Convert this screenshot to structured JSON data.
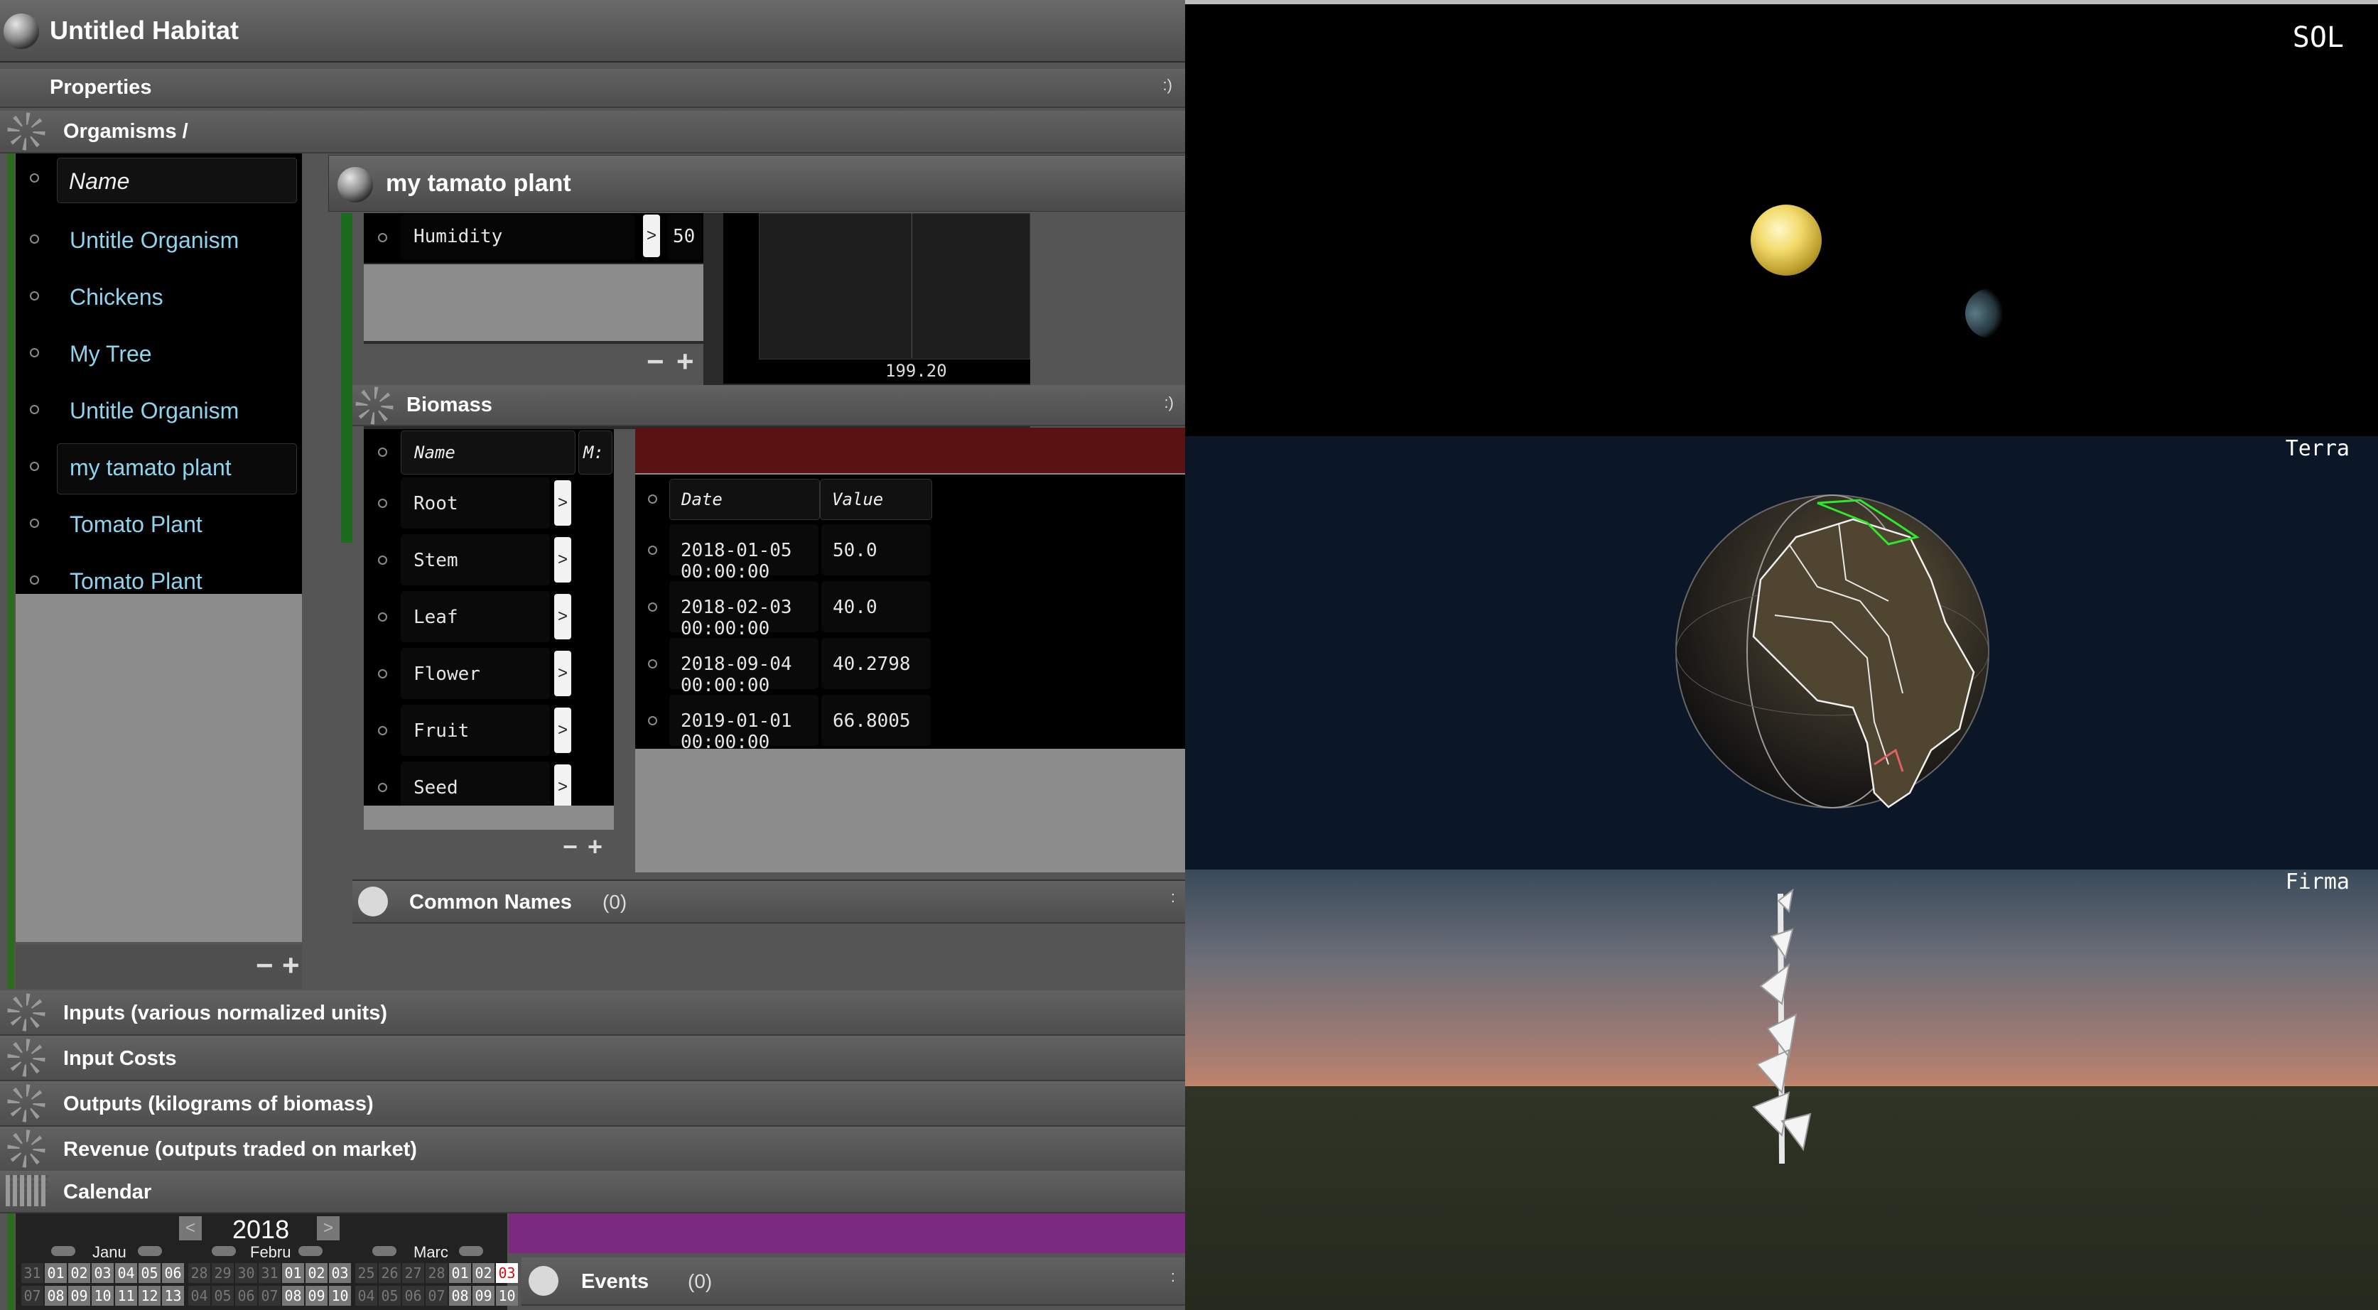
{
  "window": {
    "title": "Untitled Habitat"
  },
  "properties": {
    "label": "Properties",
    "ctrl": ":)"
  },
  "organisms": {
    "header": "Orgamisms /",
    "column_header": "Name",
    "items": [
      "Untitle Organism",
      "Chickens",
      "My Tree",
      "Untitle Organism",
      "my tamato plant",
      "Tomato Plant",
      "Tomato Plant"
    ],
    "selected_index": 4,
    "remove_label": "−",
    "add_label": "+"
  },
  "detail": {
    "title": "my tamato plant",
    "humidity": {
      "label": "Humidity",
      "arrow": ">",
      "value": "50"
    },
    "chart_readout": "199.20",
    "remove_label": "−",
    "add_label": "+"
  },
  "biomass": {
    "label": "Biomass",
    "ctrl": ":)",
    "name_header": "Name",
    "second_header": "M:",
    "parts": [
      {
        "name": "Root",
        "arrow": ">"
      },
      {
        "name": "Stem",
        "arrow": ">"
      },
      {
        "name": "Leaf",
        "arrow": ">"
      },
      {
        "name": "Flower",
        "arrow": ">"
      },
      {
        "name": "Fruit",
        "arrow": ">"
      },
      {
        "name": "Seed",
        "arrow": ">"
      }
    ],
    "table": {
      "date_header": "Date",
      "value_header": "Value",
      "rows": [
        {
          "date": "2018-01-05 00:00:00",
          "value": "50.0"
        },
        {
          "date": "2018-02-03 00:00:00",
          "value": "40.0"
        },
        {
          "date": "2018-09-04 00:00:00",
          "value": "40.2798"
        },
        {
          "date": "2019-01-01 00:00:00",
          "value": "66.8005"
        }
      ]
    },
    "remove_label": "−",
    "add_label": "+"
  },
  "common_names": {
    "label": "Common Names",
    "count": "(0)",
    "ctrl": ":"
  },
  "sections": [
    "Inputs (various normalized units)",
    "Input Costs",
    "Outputs (kilograms of biomass)",
    "Revenue (outputs traded on market)"
  ],
  "calendar": {
    "label": "Calendar",
    "year": "2018",
    "prev": "<",
    "next": ">",
    "months": [
      "Janu",
      "Febru",
      "Marc"
    ],
    "rows": [
      [
        "31",
        "01",
        "02",
        "03",
        "04",
        "05",
        "06",
        "28",
        "29",
        "30",
        "31",
        "01",
        "02",
        "03",
        "25",
        "26",
        "27",
        "28",
        "01",
        "02",
        "03"
      ],
      [
        "07",
        "08",
        "09",
        "10",
        "11",
        "12",
        "13",
        "04",
        "05",
        "06",
        "07",
        "08",
        "09",
        "10",
        "04",
        "05",
        "06",
        "07",
        "08",
        "09",
        "10"
      ]
    ],
    "today_index": 20,
    "highlight_color": "#7a2a80"
  },
  "events": {
    "label": "Events",
    "count": "(0)",
    "ctrl": ":"
  },
  "viewports": {
    "sol": "SOL",
    "terra": "Terra",
    "firma": "Firma"
  },
  "colors": {
    "accent_list_text": "#8fd3ee",
    "biomass_header": "#5a1212",
    "events_bar": "#7a2a80"
  }
}
